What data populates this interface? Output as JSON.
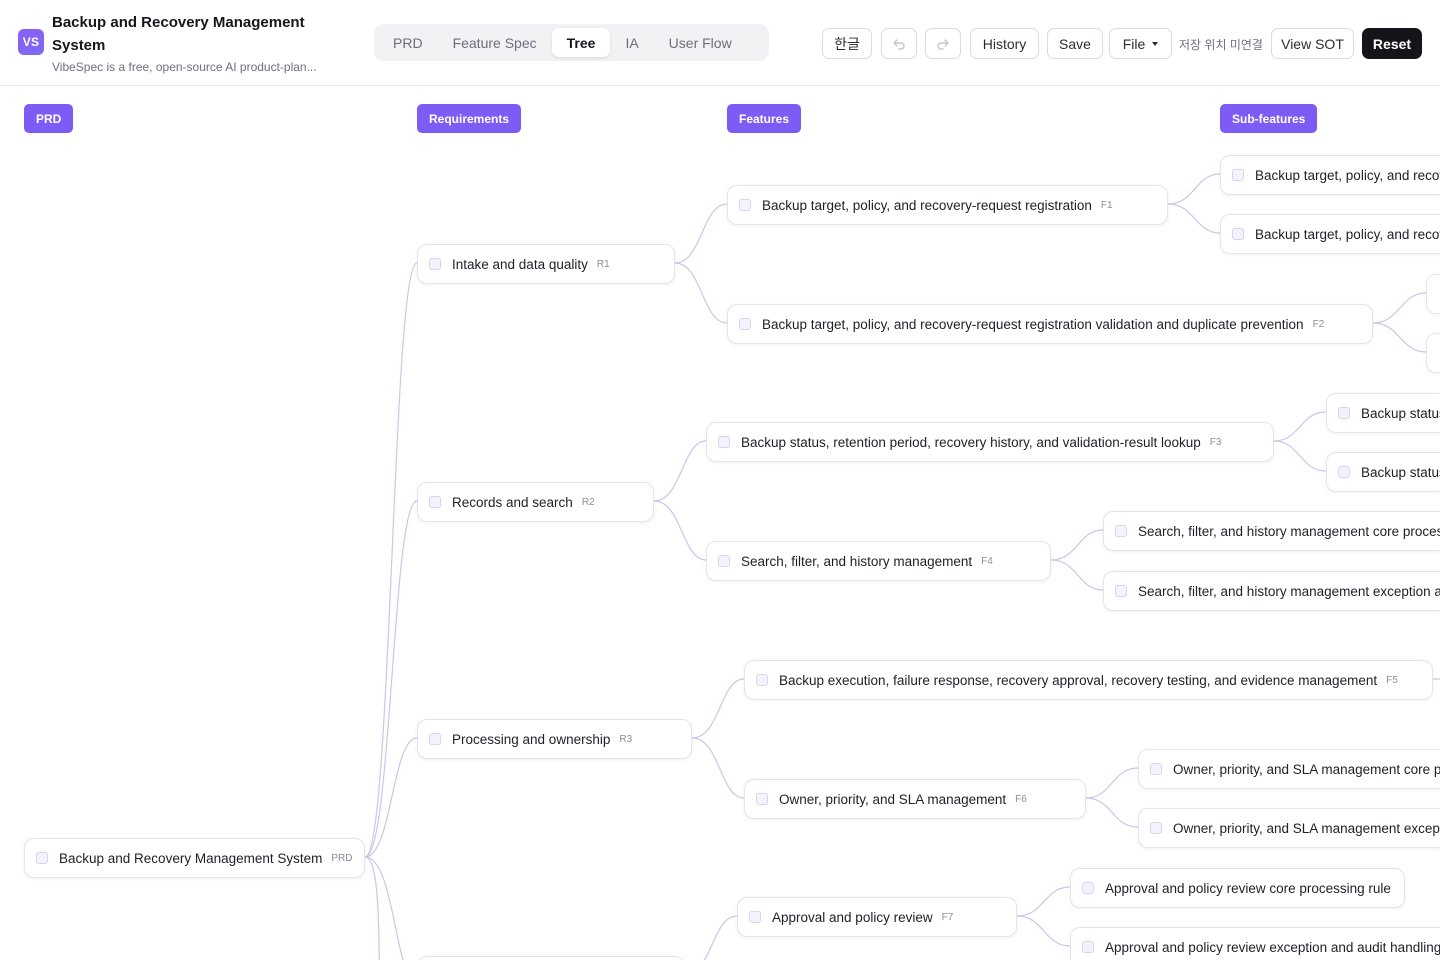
{
  "app": {
    "logo_text": "VS",
    "title": "Backup and Recovery Management System",
    "subtitle": "VibeSpec is a free, open-source AI product-plan..."
  },
  "tabs": [
    "PRD",
    "Feature Spec",
    "Tree",
    "IA",
    "User Flow"
  ],
  "active_tab": "Tree",
  "toolbar": {
    "language": "한글",
    "undo_icon": "undo-icon",
    "redo_icon": "redo-icon",
    "history": "History",
    "save": "Save",
    "file": "File",
    "save_status": "저장 위치 미연결",
    "view_sot": "View SOT",
    "reset": "Reset"
  },
  "columns": [
    "PRD",
    "Requirements",
    "Features",
    "Sub-features"
  ],
  "colors": {
    "accent": "#7c5cf5",
    "edge": "#cbc6ea",
    "dark_button": "#141519"
  },
  "tree": {
    "root": {
      "label": "Backup and Recovery Management System",
      "code": "PRD"
    },
    "requirements": [
      {
        "label": "Intake and data quality",
        "code": "R1"
      },
      {
        "label": "Records and search",
        "code": "R2"
      },
      {
        "label": "Processing and ownership",
        "code": "R3"
      }
    ],
    "features": [
      {
        "label": "Backup target, policy, and recovery-request registration",
        "code": "F1"
      },
      {
        "label": "Backup target, policy, and recovery-request registration validation and duplicate prevention",
        "code": "F2"
      },
      {
        "label": "Backup status, retention period, recovery history, and validation-result lookup",
        "code": "F3"
      },
      {
        "label": "Search, filter, and history management",
        "code": "F4"
      },
      {
        "label": "Backup execution, failure response, recovery approval, recovery testing, and evidence management",
        "code": "F5"
      },
      {
        "label": "Owner, priority, and SLA management",
        "code": "F6"
      },
      {
        "label": "Approval and policy review",
        "code": "F7"
      }
    ],
    "subfeatures": [
      {
        "label": "Backup target, policy, and recove"
      },
      {
        "label": "Backup target, policy, and recove"
      },
      {
        "label": "Backup status,"
      },
      {
        "label": "Backup status,"
      },
      {
        "label": "Search, filter, and history management core processin"
      },
      {
        "label": "Search, filter, and history management exception and"
      },
      {
        "label": "Owner, priority, and SLA management core proc"
      },
      {
        "label": "Owner, priority, and SLA management exceptio"
      },
      {
        "label": "Approval and policy review core processing rule"
      },
      {
        "label": "Approval and policy review exception and audit handling"
      }
    ]
  }
}
